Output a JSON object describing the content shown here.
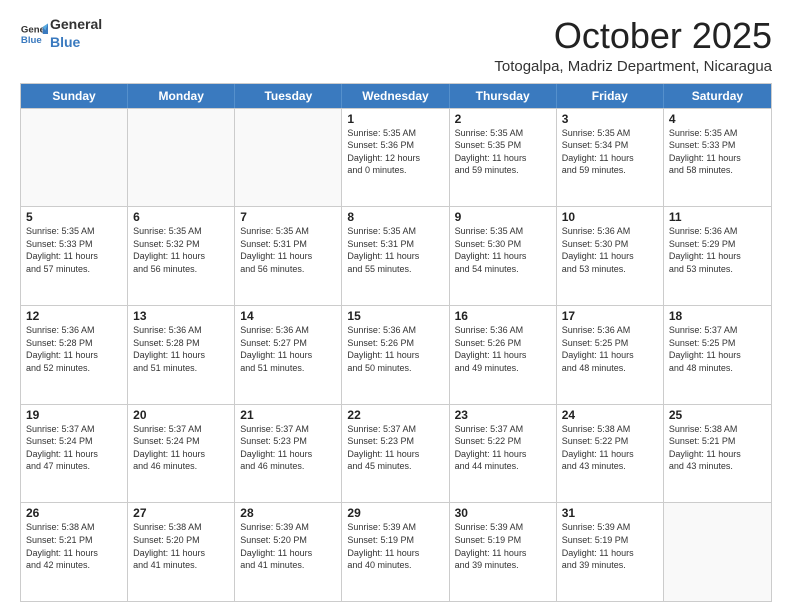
{
  "header": {
    "logo_general": "General",
    "logo_blue": "Blue",
    "month_title": "October 2025",
    "location": "Totogalpa, Madriz Department, Nicaragua"
  },
  "calendar": {
    "weekdays": [
      "Sunday",
      "Monday",
      "Tuesday",
      "Wednesday",
      "Thursday",
      "Friday",
      "Saturday"
    ],
    "rows": [
      [
        {
          "day": "",
          "info": ""
        },
        {
          "day": "",
          "info": ""
        },
        {
          "day": "",
          "info": ""
        },
        {
          "day": "1",
          "info": "Sunrise: 5:35 AM\nSunset: 5:36 PM\nDaylight: 12 hours\nand 0 minutes."
        },
        {
          "day": "2",
          "info": "Sunrise: 5:35 AM\nSunset: 5:35 PM\nDaylight: 11 hours\nand 59 minutes."
        },
        {
          "day": "3",
          "info": "Sunrise: 5:35 AM\nSunset: 5:34 PM\nDaylight: 11 hours\nand 59 minutes."
        },
        {
          "day": "4",
          "info": "Sunrise: 5:35 AM\nSunset: 5:33 PM\nDaylight: 11 hours\nand 58 minutes."
        }
      ],
      [
        {
          "day": "5",
          "info": "Sunrise: 5:35 AM\nSunset: 5:33 PM\nDaylight: 11 hours\nand 57 minutes."
        },
        {
          "day": "6",
          "info": "Sunrise: 5:35 AM\nSunset: 5:32 PM\nDaylight: 11 hours\nand 56 minutes."
        },
        {
          "day": "7",
          "info": "Sunrise: 5:35 AM\nSunset: 5:31 PM\nDaylight: 11 hours\nand 56 minutes."
        },
        {
          "day": "8",
          "info": "Sunrise: 5:35 AM\nSunset: 5:31 PM\nDaylight: 11 hours\nand 55 minutes."
        },
        {
          "day": "9",
          "info": "Sunrise: 5:35 AM\nSunset: 5:30 PM\nDaylight: 11 hours\nand 54 minutes."
        },
        {
          "day": "10",
          "info": "Sunrise: 5:36 AM\nSunset: 5:30 PM\nDaylight: 11 hours\nand 53 minutes."
        },
        {
          "day": "11",
          "info": "Sunrise: 5:36 AM\nSunset: 5:29 PM\nDaylight: 11 hours\nand 53 minutes."
        }
      ],
      [
        {
          "day": "12",
          "info": "Sunrise: 5:36 AM\nSunset: 5:28 PM\nDaylight: 11 hours\nand 52 minutes."
        },
        {
          "day": "13",
          "info": "Sunrise: 5:36 AM\nSunset: 5:28 PM\nDaylight: 11 hours\nand 51 minutes."
        },
        {
          "day": "14",
          "info": "Sunrise: 5:36 AM\nSunset: 5:27 PM\nDaylight: 11 hours\nand 51 minutes."
        },
        {
          "day": "15",
          "info": "Sunrise: 5:36 AM\nSunset: 5:26 PM\nDaylight: 11 hours\nand 50 minutes."
        },
        {
          "day": "16",
          "info": "Sunrise: 5:36 AM\nSunset: 5:26 PM\nDaylight: 11 hours\nand 49 minutes."
        },
        {
          "day": "17",
          "info": "Sunrise: 5:36 AM\nSunset: 5:25 PM\nDaylight: 11 hours\nand 48 minutes."
        },
        {
          "day": "18",
          "info": "Sunrise: 5:37 AM\nSunset: 5:25 PM\nDaylight: 11 hours\nand 48 minutes."
        }
      ],
      [
        {
          "day": "19",
          "info": "Sunrise: 5:37 AM\nSunset: 5:24 PM\nDaylight: 11 hours\nand 47 minutes."
        },
        {
          "day": "20",
          "info": "Sunrise: 5:37 AM\nSunset: 5:24 PM\nDaylight: 11 hours\nand 46 minutes."
        },
        {
          "day": "21",
          "info": "Sunrise: 5:37 AM\nSunset: 5:23 PM\nDaylight: 11 hours\nand 46 minutes."
        },
        {
          "day": "22",
          "info": "Sunrise: 5:37 AM\nSunset: 5:23 PM\nDaylight: 11 hours\nand 45 minutes."
        },
        {
          "day": "23",
          "info": "Sunrise: 5:37 AM\nSunset: 5:22 PM\nDaylight: 11 hours\nand 44 minutes."
        },
        {
          "day": "24",
          "info": "Sunrise: 5:38 AM\nSunset: 5:22 PM\nDaylight: 11 hours\nand 43 minutes."
        },
        {
          "day": "25",
          "info": "Sunrise: 5:38 AM\nSunset: 5:21 PM\nDaylight: 11 hours\nand 43 minutes."
        }
      ],
      [
        {
          "day": "26",
          "info": "Sunrise: 5:38 AM\nSunset: 5:21 PM\nDaylight: 11 hours\nand 42 minutes."
        },
        {
          "day": "27",
          "info": "Sunrise: 5:38 AM\nSunset: 5:20 PM\nDaylight: 11 hours\nand 41 minutes."
        },
        {
          "day": "28",
          "info": "Sunrise: 5:39 AM\nSunset: 5:20 PM\nDaylight: 11 hours\nand 41 minutes."
        },
        {
          "day": "29",
          "info": "Sunrise: 5:39 AM\nSunset: 5:19 PM\nDaylight: 11 hours\nand 40 minutes."
        },
        {
          "day": "30",
          "info": "Sunrise: 5:39 AM\nSunset: 5:19 PM\nDaylight: 11 hours\nand 39 minutes."
        },
        {
          "day": "31",
          "info": "Sunrise: 5:39 AM\nSunset: 5:19 PM\nDaylight: 11 hours\nand 39 minutes."
        },
        {
          "day": "",
          "info": ""
        }
      ]
    ]
  }
}
